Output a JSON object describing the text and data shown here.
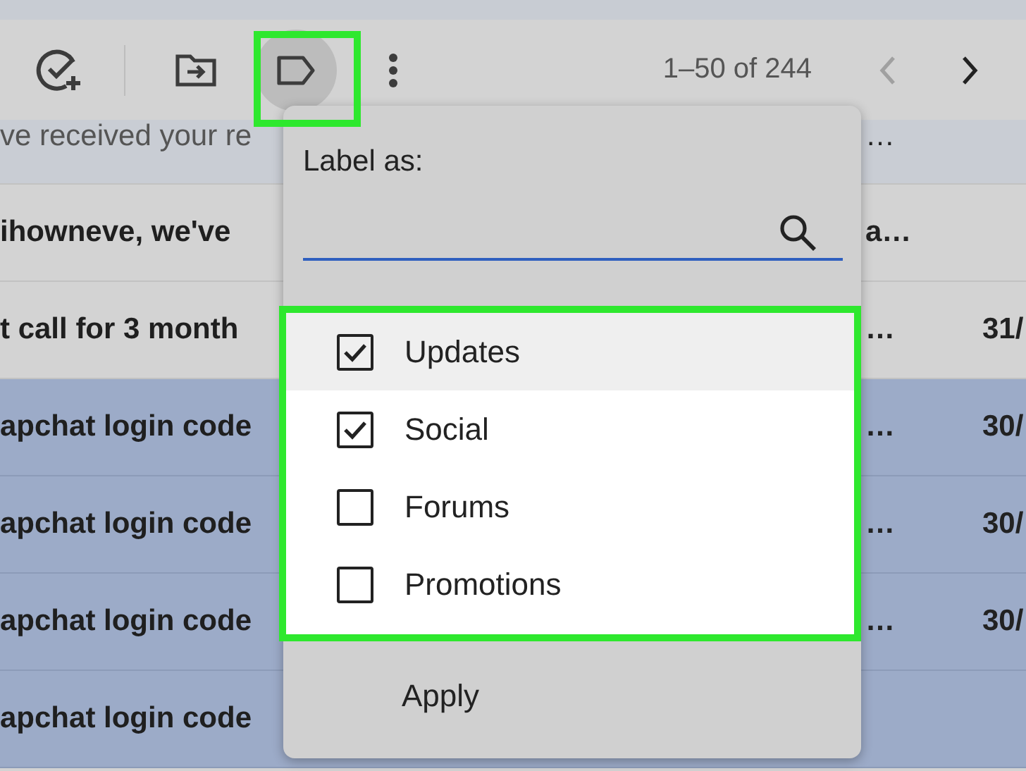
{
  "toolbar": {
    "label_button": {
      "active": true
    },
    "pagination": "1–50 of 244",
    "nav": [
      {
        "kind": "prev",
        "disabled": true
      },
      {
        "kind": "next",
        "disabled": false
      }
    ]
  },
  "emails": [
    {
      "text": "ve received your re",
      "unread": false,
      "selected": false,
      "tail": "…"
    },
    {
      "text": "ihowneve, we've",
      "unread": true,
      "selected": false,
      "tail": "a…"
    },
    {
      "text": "t call for 3 month",
      "unread": true,
      "selected": false,
      "tail": "…",
      "date": "31/"
    },
    {
      "text": "apchat login code",
      "unread": true,
      "selected": true,
      "tail": "…",
      "date": "30/"
    },
    {
      "text": "apchat login code",
      "unread": true,
      "selected": true,
      "tail": "…",
      "date": "30/"
    },
    {
      "text": "apchat login code",
      "unread": true,
      "selected": true,
      "tail": "…",
      "date": "30/"
    },
    {
      "text": "apchat login code",
      "unread": true,
      "selected": true
    }
  ],
  "label_menu": {
    "title": "Label as:",
    "labels": [
      {
        "name": "Updates",
        "checked": true,
        "highlighted": true
      },
      {
        "name": "Social",
        "checked": true,
        "highlighted": false
      },
      {
        "name": "Forums",
        "checked": false,
        "highlighted": false
      },
      {
        "name": "Promotions",
        "checked": false,
        "highlighted": false
      }
    ],
    "apply": "Apply"
  }
}
